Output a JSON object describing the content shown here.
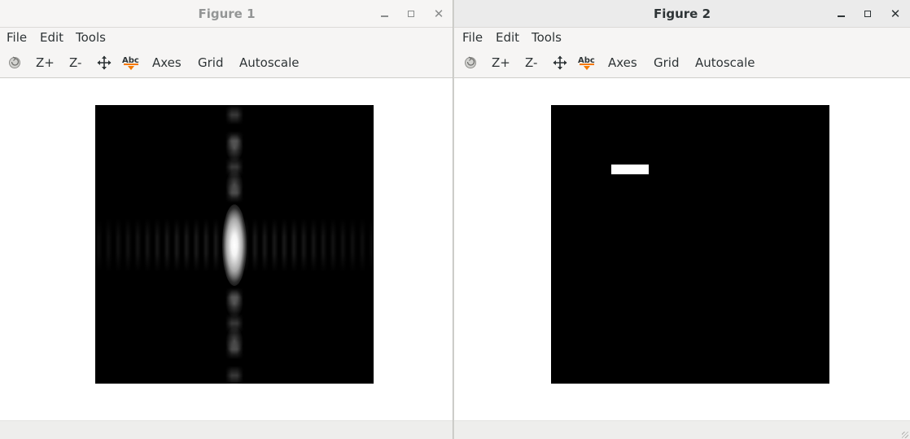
{
  "windows": [
    {
      "title": "Figure 1",
      "menu": [
        "File",
        "Edit",
        "Tools"
      ],
      "toolbar": {
        "zoom_in": "Z+",
        "zoom_out": "Z-",
        "text_icon_label": "Abc",
        "axes": "Axes",
        "grid": "Grid",
        "autoscale": "Autoscale"
      },
      "image": "2D Fourier magnitude (sinc pattern) rendered in grayscale"
    },
    {
      "title": "Figure 2",
      "menu": [
        "File",
        "Edit",
        "Tools"
      ],
      "toolbar": {
        "zoom_in": "Z+",
        "zoom_out": "Z-",
        "text_icon_label": "Abc",
        "axes": "Axes",
        "grid": "Grid",
        "autoscale": "Autoscale"
      },
      "image": "black image with small white rectangle"
    }
  ],
  "colors": {
    "titlebar_bg": "#f6f5f4",
    "toolbar_bg": "#f6f5f4",
    "text": "#2e3436",
    "inactive_title": "#939595",
    "image_bg": "#000000",
    "rect": "#ffffff",
    "abc_icon_accent": "#f57900"
  }
}
